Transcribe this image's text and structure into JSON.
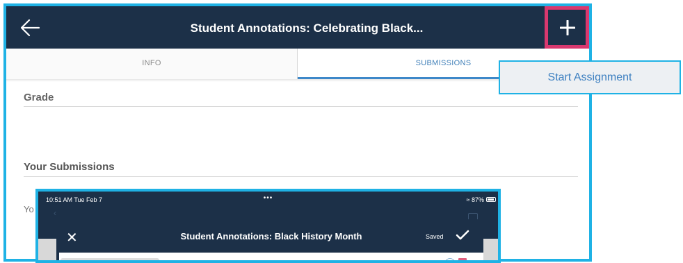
{
  "main": {
    "nav": {
      "title": "Student Annotations: Celebrating Black...",
      "back_icon": "arrow-left-icon",
      "add_icon": "plus-icon"
    },
    "tabs": [
      {
        "label": "INFO"
      },
      {
        "label": "SUBMISSIONS",
        "selected": true
      }
    ],
    "sections": {
      "grade": "Grade",
      "your_submissions": "Your Submissions",
      "partial_text": "Yo"
    }
  },
  "popover": {
    "start_assignment": "Start Assignment"
  },
  "inset": {
    "status": {
      "time": "10:51 AM  Tue Feb 7",
      "dots": "•••",
      "battery": "87%"
    },
    "header": {
      "close_icon": "close-icon",
      "title": "Student Annotations: Black History Month",
      "saved": "Saved",
      "check_icon": "checkmark-icon"
    }
  },
  "colors": {
    "nav_bg": "#1c3048",
    "highlight_border": "#1fb2e5",
    "add_button_border": "#d9386f",
    "tab_selected": "#3d88c9",
    "link_blue": "#3c7fc0"
  }
}
